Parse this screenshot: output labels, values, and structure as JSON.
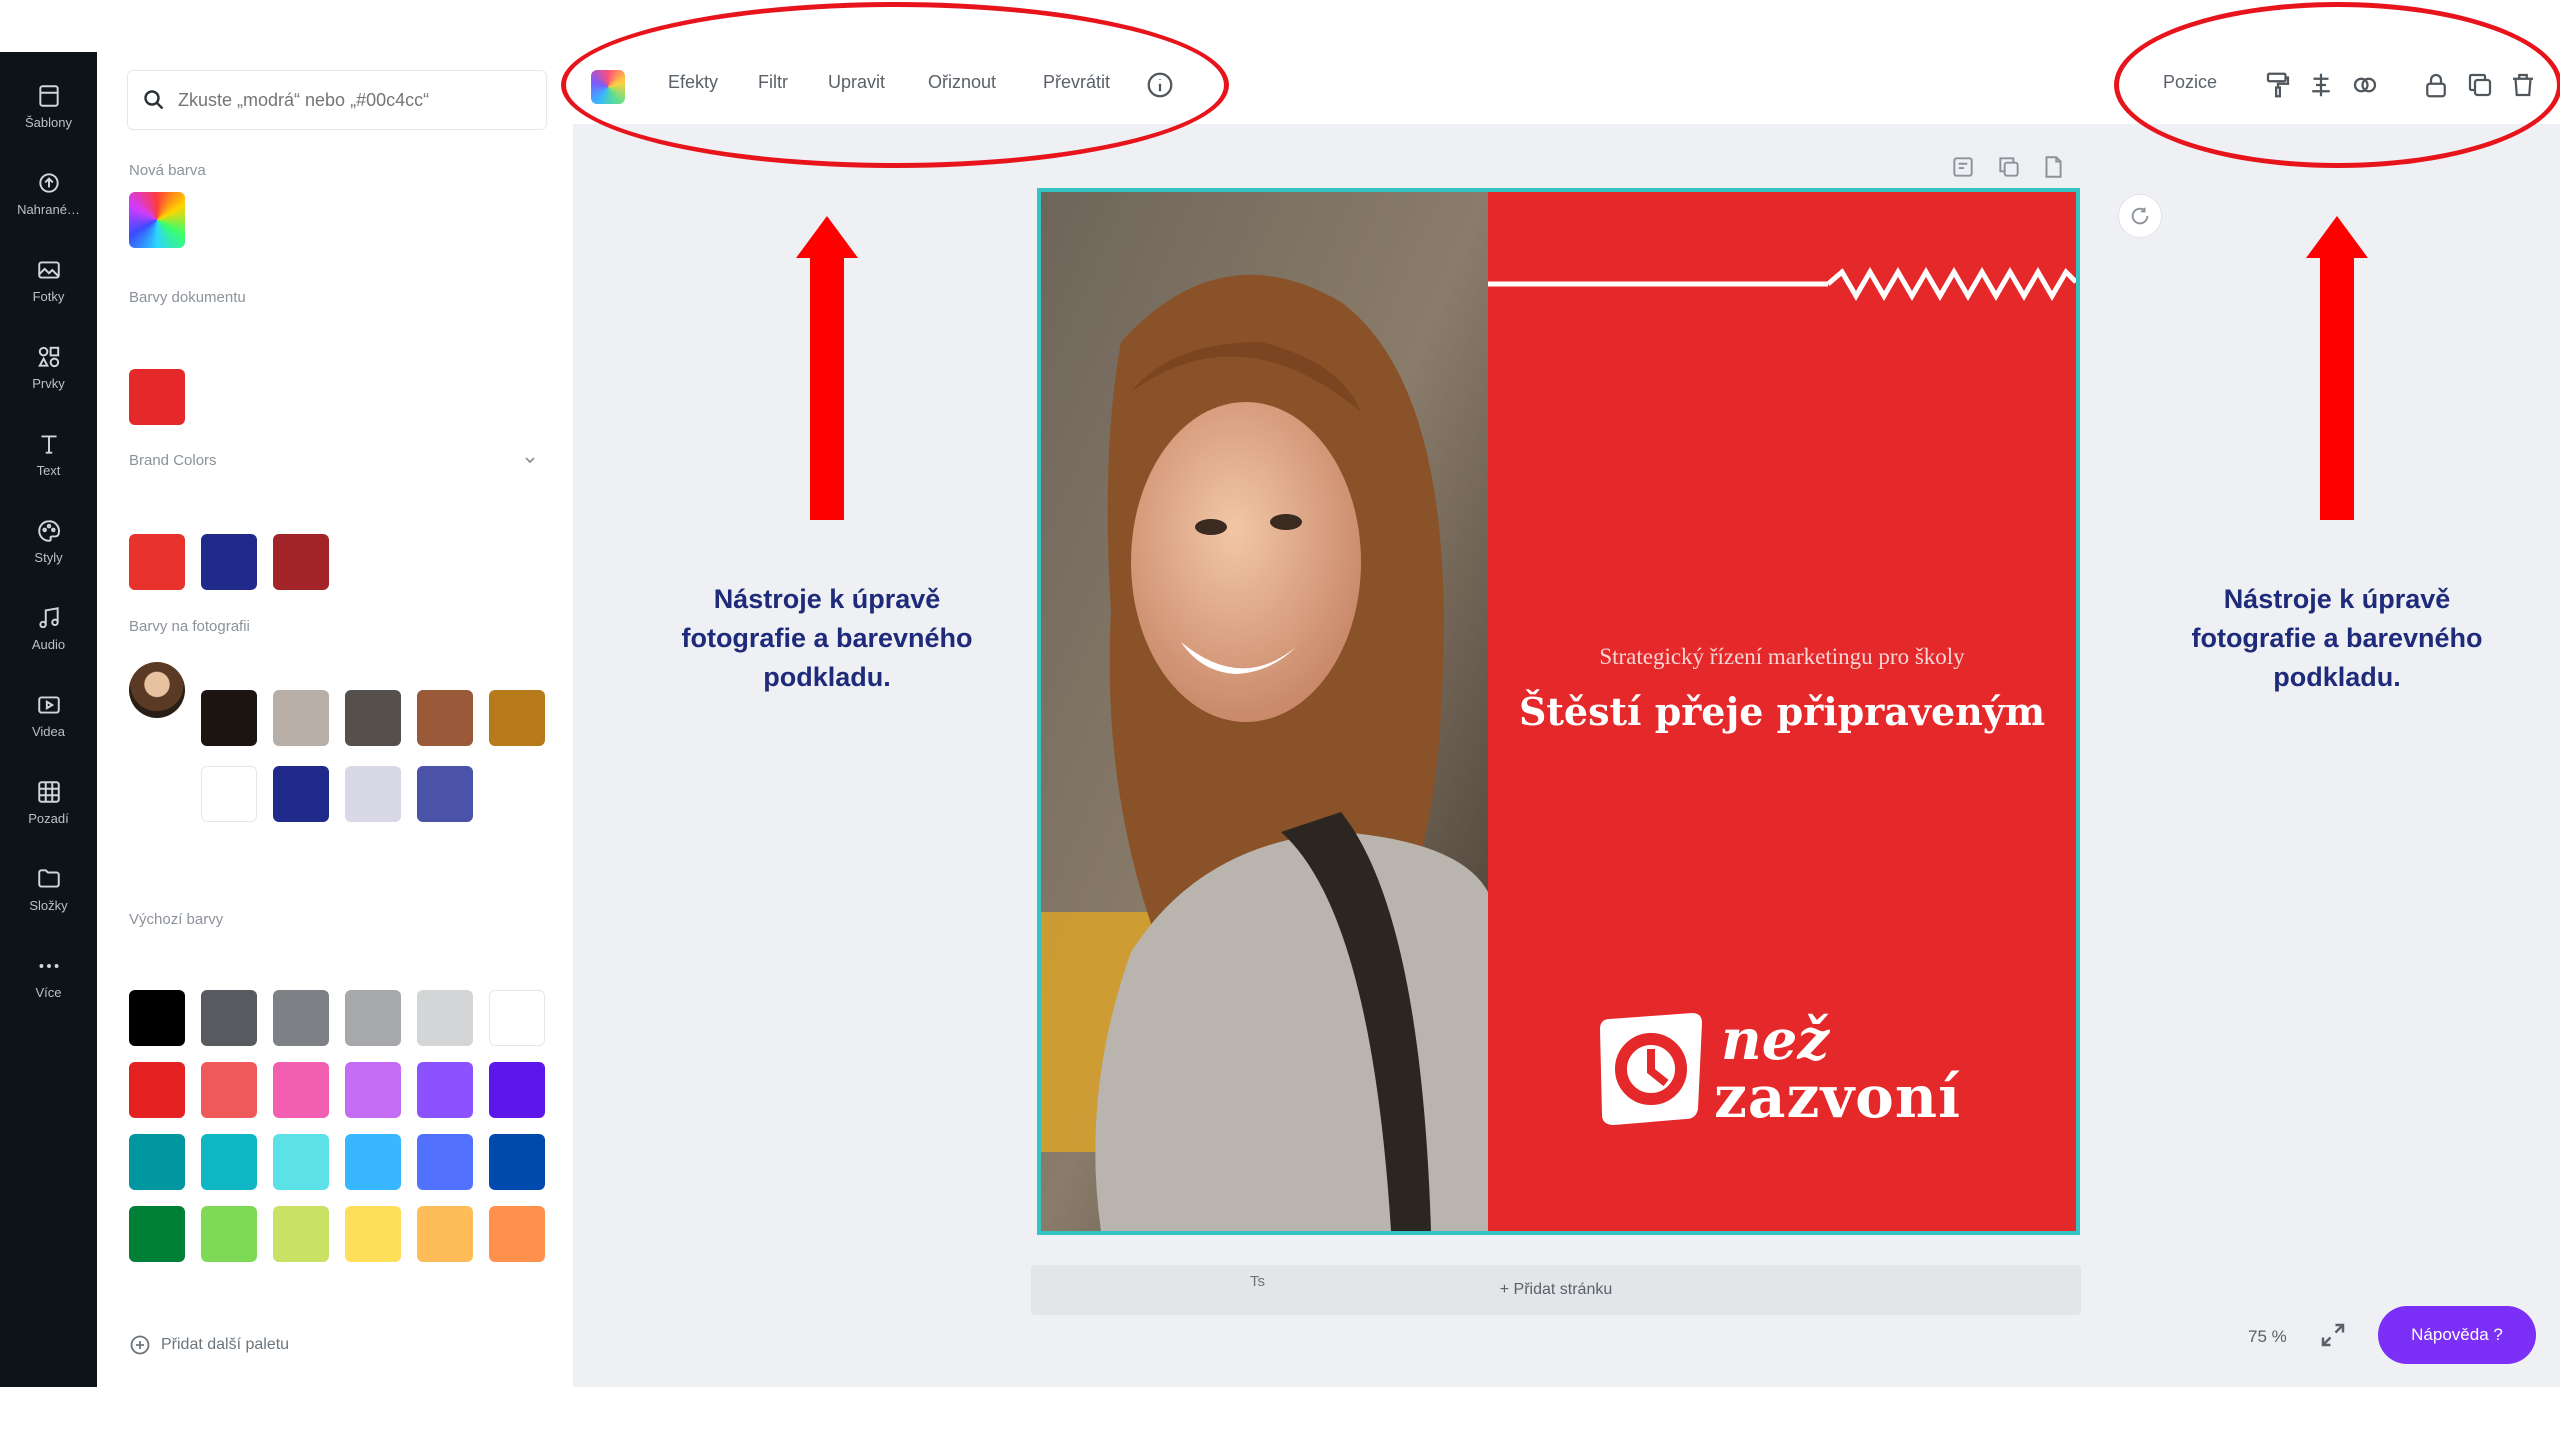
{
  "sidebar": {
    "items": [
      {
        "label": "Šablony",
        "icon": "template-icon"
      },
      {
        "label": "Nahrané…",
        "icon": "upload-icon"
      },
      {
        "label": "Fotky",
        "icon": "photo-icon"
      },
      {
        "label": "Prvky",
        "icon": "elements-icon"
      },
      {
        "label": "Text",
        "icon": "text-icon"
      },
      {
        "label": "Styly",
        "icon": "styles-icon"
      },
      {
        "label": "Audio",
        "icon": "audio-icon"
      },
      {
        "label": "Videa",
        "icon": "video-icon"
      },
      {
        "label": "Pozadí",
        "icon": "background-icon"
      },
      {
        "label": "Složky",
        "icon": "folder-icon"
      },
      {
        "label": "Více",
        "icon": "more-icon"
      }
    ]
  },
  "color_panel": {
    "search_placeholder": "Zkuste „modrá“ nebo „#00c4cc“",
    "new_color_title": "Nová barva",
    "document_colors_title": "Barvy dokumentu",
    "document_colors": [
      "#e5282a"
    ],
    "brand_colors_title": "Brand Colors",
    "brand_colors": [
      "#e8322c",
      "#1f2a8a",
      "#a32428"
    ],
    "photo_colors_title": "Barvy na fotografii",
    "photo_colors_row1": [
      "#1c1410",
      "#b7aea8",
      "#56504c",
      "#9a5a3a",
      "#b77a1a"
    ],
    "photo_colors_row2": [
      "#ffffff",
      "#1f2a8a",
      "#d8d8e6",
      "#4b53a8"
    ],
    "default_colors_title": "Výchozí barvy",
    "default_colors": [
      [
        "#000000",
        "#575b5f",
        "#7d8084",
        "#a6a8ab",
        "#d4d5d6",
        "#ffffff"
      ],
      [
        "#e52222",
        "#f0595a",
        "#f25fb1",
        "#c46cf3",
        "#8c52ff",
        "#5e17eb"
      ],
      [
        "#0097a0",
        "#0fb7c4",
        "#5ce1e6",
        "#38b6ff",
        "#5271ff",
        "#004aad"
      ],
      [
        "#008037",
        "#7ed957",
        "#c9e265",
        "#ffde59",
        "#ffbd59",
        "#ff914d"
      ]
    ],
    "add_palette": "Přidat další paletu"
  },
  "toolbar": {
    "menu": [
      "Efekty",
      "Filtr",
      "Upravit",
      "Ořiznout",
      "Převrátit"
    ],
    "position_label": "Pozice"
  },
  "design": {
    "subtitle": "Strategický řízení marketingu pro školy",
    "headline": "Štěstí přeje připraveným",
    "brand_line1": "než",
    "brand_line2": "zazvoní",
    "page_number": "Ts",
    "add_page": "+ Přidat stránku"
  },
  "status": {
    "zoom": "75 %",
    "present_button": "Nápověda ?"
  },
  "annotations": {
    "left_text": "Nástroje k úpravě fotografie a barevného podkladu.",
    "right_text": "Nástroje k úpravě fotografie a barevného podkladu."
  },
  "colors": {
    "accent_red": "#e5282a",
    "annotation_red": "#e8141c",
    "annotation_text": "#1e2a7a",
    "selection_teal": "#34c2c2",
    "present_purple": "#7b2ff7"
  }
}
